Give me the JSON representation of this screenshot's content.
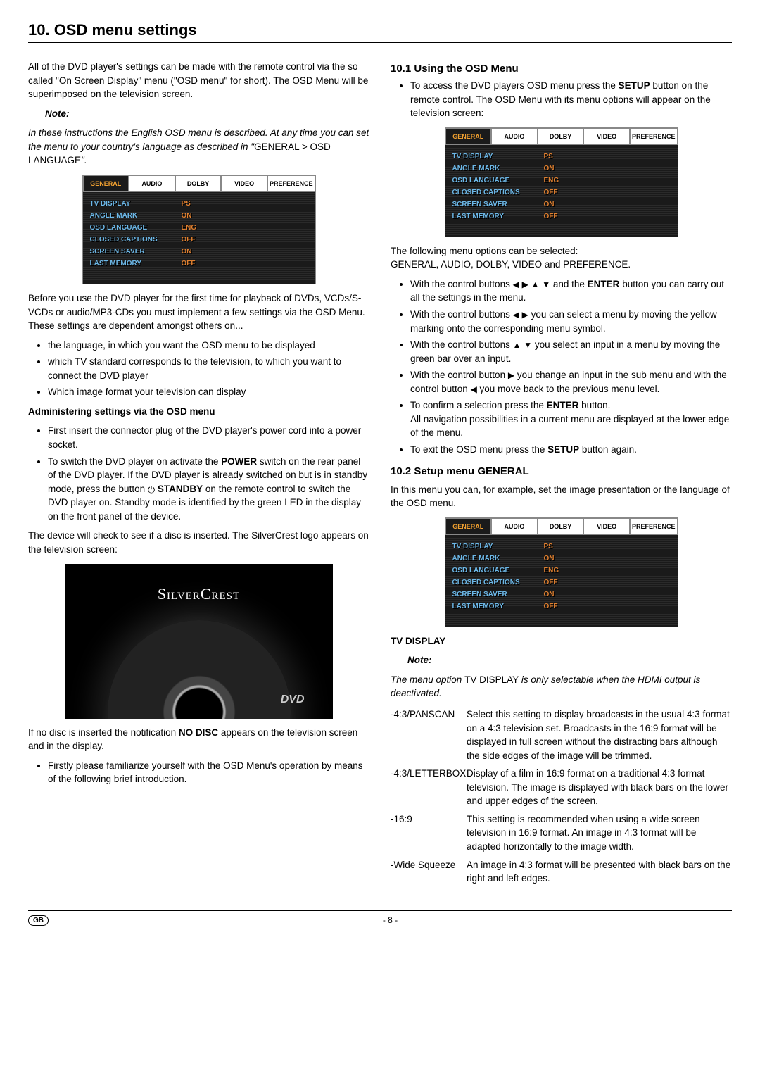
{
  "heading": "10. OSD menu settings",
  "left": {
    "intro": "All of the DVD player's settings can be made with the remote control via the so called \"On Screen Display\" menu (\"OSD menu\" for short). The OSD Menu will be superimposed on the television screen.",
    "note_label": "Note:",
    "note_pre": "In these instructions the English OSD menu is described. At any time you can set the menu to your country's language as described in \"",
    "note_path": "GENERAL > OSD LANGUAGE",
    "note_post": "\".",
    "before_first": "Before you use the DVD player for the first time for playback of DVDs, VCDs/S-VCDs or audio/MP3-CDs you must implement a few settings via the OSD Menu. These settings are dependent amongst others on...",
    "bullets1": [
      "the language, in which you want the OSD menu to be displayed",
      "which TV standard corresponds to the television, to which you want to connect the DVD player",
      "Which image format your television can display"
    ],
    "admin_heading": "Administering settings via the OSD menu",
    "admin_b1": "First insert the connector plug of the DVD player's power cord into a power socket.",
    "admin_b2a": "To switch the DVD player on activate the ",
    "admin_b2_power": "POWER",
    "admin_b2b": " switch on the rear panel of the DVD player. If the DVD player is already switched on but is in standby mode, press the button ",
    "admin_b2_standby": "STANDBY",
    "admin_b2c": " on the remote control to switch the DVD player on. Standby mode is identified by the green LED in the display on the front panel of the device.",
    "device_check": "The device will check to see if a disc is inserted. The SilverCrest logo appears on the television screen:",
    "silvercrest": "SilverCrest",
    "dvd": "DVD",
    "no_disc_pre": "If no disc is inserted the notification ",
    "no_disc_word": "NO DISC",
    "no_disc_post": " appears on the television screen and in the display.",
    "familiarize": "Firstly please familiarize yourself with the OSD Menu's operation by means of the following brief introduction."
  },
  "right": {
    "h1": "10.1 Using the OSD Menu",
    "r1a": "To access the DVD players OSD menu press the ",
    "setup": "SETUP",
    "r1b": " button on the remote control. The OSD Menu with its menu options will appear on the television screen:",
    "following_pre": "The following menu options can be selected:",
    "following_opts": "GENERAL, AUDIO, DOLBY, VIDEO and PREFERENCE.",
    "bul1a": "With the control buttons ",
    "bul1b": " and the ",
    "enter": "ENTER",
    "bul1c": " button you can carry out all the settings in the menu.",
    "bul2a": "With the control buttons ",
    "bul2b": " you can select a menu by moving the yellow marking onto the corresponding menu symbol.",
    "bul3a": "With the control buttons ",
    "bul3b": " you select an input in a menu by moving the green bar over an input.",
    "bul4a": "With the control button ",
    "bul4b": " you change an input in the sub menu and with the control button ",
    "bul4c": " you move back to the previous menu level.",
    "bul5a": "To confirm a selection press the ",
    "bul5b": " button.",
    "bul5c": "All navigation possibilities in a current menu are displayed at the lower edge of the menu.",
    "bul6a": "To exit the OSD menu press the ",
    "bul6b": " button again.",
    "h2": "10.2 Setup menu GENERAL",
    "h2_text": "In this menu you can, for example, set the image presentation or the language of the OSD menu.",
    "tv_display_heading": "TV DISPLAY",
    "note2_label": "Note:",
    "note2_pre": "The menu option ",
    "note2_word": "TV DISPLAY",
    "note2_post": " is only selectable when the HDMI output is deactivated.",
    "defs": [
      {
        "term": "-4:3/PANSCAN",
        "text": "Select this setting to display broadcasts in the usual 4:3 format on a 4:3 television set. Broadcasts in the 16:9 format will be displayed in full screen without the distracting bars although the side edges of the image will be trimmed."
      },
      {
        "term": "-4:3/LETTERBOX",
        "text": "Display of a film in 16:9 format on a traditional 4:3 format television. The image is displayed with black bars on the lower and upper edges of the screen."
      },
      {
        "term": "-16:9",
        "text": "This setting is recommended when using a wide screen television in 16:9 format. An image in 4:3 format will be adapted horizontally to the image width."
      },
      {
        "term": "-Wide Squeeze",
        "text": "An image in 4:3 format will be presented with black bars on the right and left edges."
      }
    ]
  },
  "osd": {
    "tabs": [
      "GENERAL",
      "AUDIO",
      "DOLBY",
      "VIDEO",
      "PREFERENCE"
    ],
    "rows": [
      {
        "k": "TV DISPLAY",
        "v": "PS"
      },
      {
        "k": "ANGLE MARK",
        "v": "ON"
      },
      {
        "k": "OSD LANGUAGE",
        "v": "ENG"
      },
      {
        "k": "CLOSED CAPTIONS",
        "v": "OFF"
      },
      {
        "k": "SCREEN SAVER",
        "v": "ON"
      },
      {
        "k": "LAST MEMORY",
        "v": "OFF"
      }
    ]
  },
  "footer": {
    "gb": "GB",
    "page": "- 8 -"
  }
}
